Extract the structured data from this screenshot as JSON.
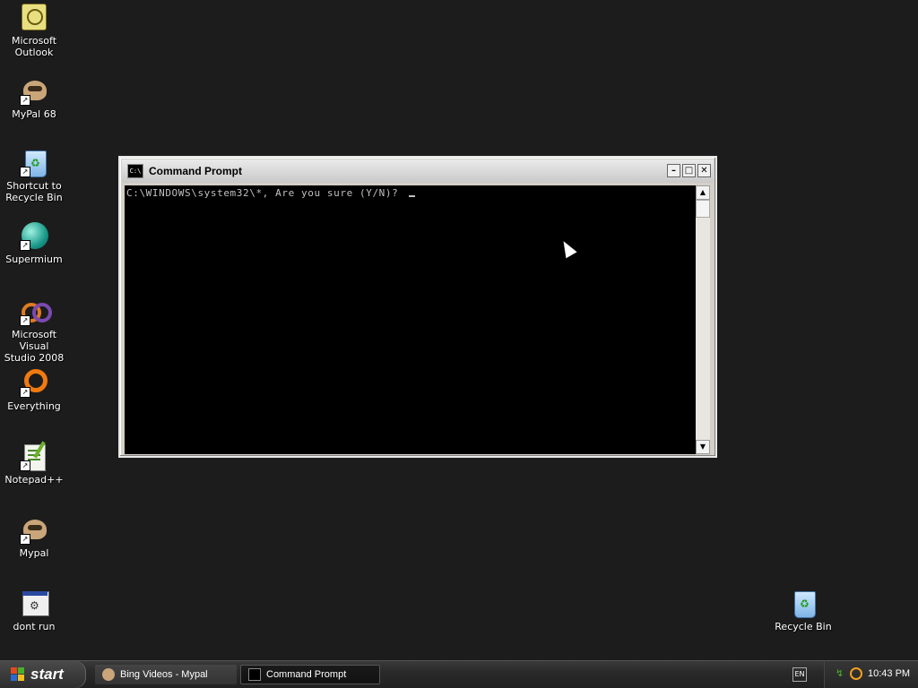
{
  "desktop": {
    "icons": [
      {
        "label_line1": "Microsoft",
        "label_line2": "Outlook",
        "icon": "outlook-icon"
      },
      {
        "label_line1": "MyPal 68",
        "label_line2": "",
        "icon": "mypal-icon"
      },
      {
        "label_line1": "Shortcut to",
        "label_line2": "Recycle Bin",
        "icon": "recycle-bin-icon"
      },
      {
        "label_line1": "Supermium",
        "label_line2": "",
        "icon": "supermium-icon"
      },
      {
        "label_line1": "Microsoft Visual",
        "label_line2": "Studio 2008",
        "icon": "visual-studio-icon"
      },
      {
        "label_line1": "Everything",
        "label_line2": "",
        "icon": "everything-icon"
      },
      {
        "label_line1": "Notepad++",
        "label_line2": "",
        "icon": "notepadpp-icon"
      },
      {
        "label_line1": "Mypal",
        "label_line2": "",
        "icon": "mypal-icon"
      },
      {
        "label_line1": "dont run",
        "label_line2": "",
        "icon": "batch-file-icon"
      }
    ],
    "recycle_bin": {
      "label": "Recycle Bin",
      "icon": "recycle-bin-icon"
    }
  },
  "cmd_window": {
    "title": "Command Prompt",
    "icon_text": "C:\\",
    "console_line": "C:\\WINDOWS\\system32\\*, Are you sure (Y/N)? ",
    "buttons": {
      "minimize": "–",
      "maximize": "□",
      "close": "✕"
    },
    "scroll": {
      "up": "▲",
      "down": "▼"
    }
  },
  "taskbar": {
    "start_label": "start",
    "tasks": [
      {
        "label": "Bing Videos - Mypal",
        "icon": "mypal-icon",
        "active": false
      },
      {
        "label": "Command Prompt",
        "icon": "cmd-icon",
        "active": true
      }
    ],
    "language": "EN",
    "clock": "10:43 PM"
  },
  "colors": {
    "desktop_bg": "#1c1c1c",
    "console_bg": "#000000",
    "console_text": "#c0c0c0"
  }
}
